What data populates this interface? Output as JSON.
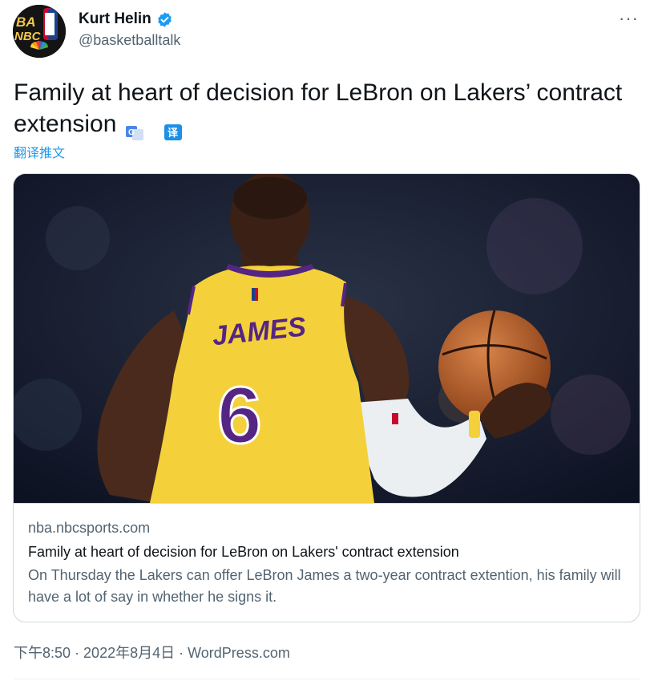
{
  "author": {
    "display_name": "Kurt Helin",
    "handle": "@basketballtalk",
    "avatar_text_top": "BA",
    "avatar_text_bottom": "NBC",
    "verified": true
  },
  "tweet": {
    "text": "Family at heart of decision for LeBron on Lakers’ contract extension",
    "translate_label": "翻译推文",
    "more_label": "···"
  },
  "card": {
    "domain": "nba.nbcsports.com",
    "title": "Family at heart of decision for LeBron on Lakers' contract extension",
    "description": "On Thursday the Lakers can offer LeBron James a two-year contract extention, his family will have a lot of say in whether he signs it.",
    "jersey_name": "JAMES",
    "jersey_number": "6"
  },
  "footer": {
    "time": "下午8:50",
    "separator": " · ",
    "date": "2022年8月4日",
    "source": "WordPress.com"
  },
  "colors": {
    "accent": "#1d9bf0",
    "text_primary": "#0f1419",
    "text_secondary": "#536471",
    "border": "#cfd9de",
    "jersey_yellow": "#f4d13b",
    "jersey_purple": "#552583"
  },
  "icons": {
    "verified": "verified-badge-icon",
    "more": "more-options-icon",
    "google_translate": "google-translate-icon",
    "yi_translate": "translate-yi-icon"
  }
}
